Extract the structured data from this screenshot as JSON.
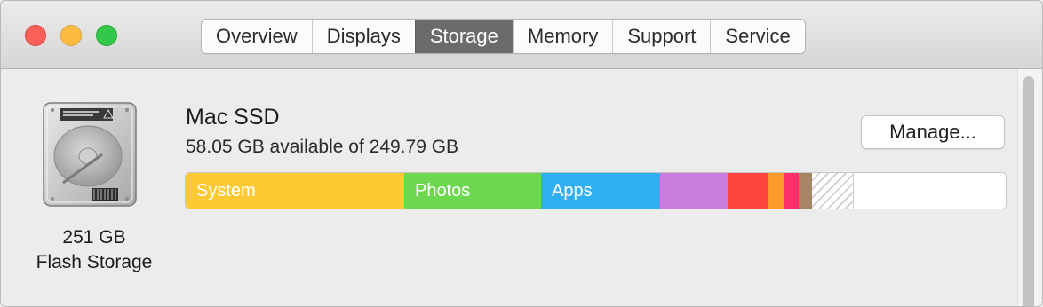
{
  "window": {
    "traffic_lights": {
      "close": "#fc605b",
      "minimize": "#fdbc40",
      "zoom": "#34c84a"
    }
  },
  "tabs": [
    {
      "label": "Overview",
      "active": false
    },
    {
      "label": "Displays",
      "active": false
    },
    {
      "label": "Storage",
      "active": true
    },
    {
      "label": "Memory",
      "active": false
    },
    {
      "label": "Support",
      "active": false
    },
    {
      "label": "Service",
      "active": false
    }
  ],
  "disk": {
    "icon": "hard-drive-icon",
    "size": "251 GB",
    "kind": "Flash Storage"
  },
  "volume": {
    "name": "Mac SSD",
    "available": "58.05 GB available of 249.79 GB"
  },
  "manage_button": {
    "label": "Manage..."
  },
  "storage_bar": {
    "segments": [
      {
        "label": "System",
        "color": "#fdca33",
        "fraction": 0.266
      },
      {
        "label": "Photos",
        "color": "#6dd750",
        "fraction": 0.167
      },
      {
        "label": "Apps",
        "color": "#2fb0f5",
        "fraction": 0.145
      },
      {
        "label": "",
        "color": "#c87ddf",
        "fraction": 0.082
      },
      {
        "label": "",
        "color": "#fc453f",
        "fraction": 0.05
      },
      {
        "label": "",
        "color": "#fd9a2c",
        "fraction": 0.019
      },
      {
        "label": "",
        "color": "#fd2f6c",
        "fraction": 0.017
      },
      {
        "label": "",
        "color": "#a58564",
        "fraction": 0.016
      },
      {
        "label": "",
        "color": "hatch",
        "fraction": 0.051
      }
    ]
  }
}
